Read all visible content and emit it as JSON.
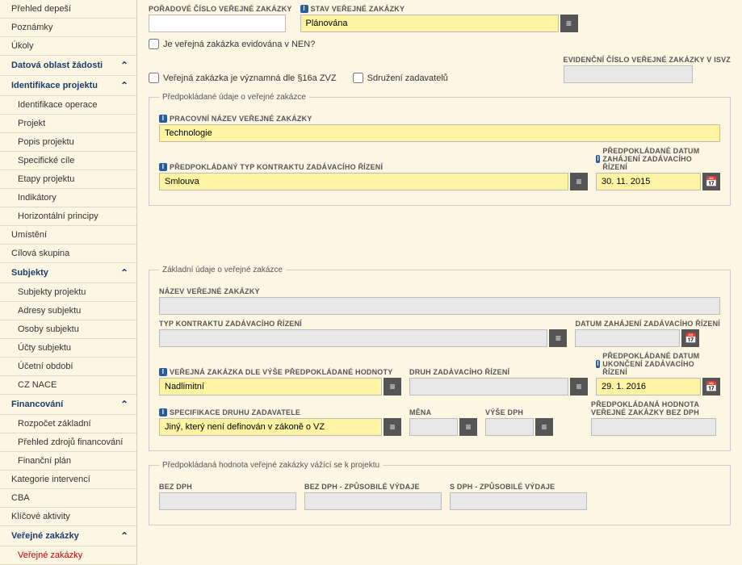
{
  "sidebar": {
    "items": [
      {
        "label": "Přehled depeší",
        "type": "item"
      },
      {
        "label": "Poznámky",
        "type": "item"
      },
      {
        "label": "Úkoly",
        "type": "item"
      },
      {
        "label": "Datová oblast žádosti",
        "type": "header",
        "expand": true
      },
      {
        "label": "Identifikace projektu",
        "type": "header",
        "expand": true
      },
      {
        "label": "Identifikace operace",
        "type": "sub"
      },
      {
        "label": "Projekt",
        "type": "sub"
      },
      {
        "label": "Popis projektu",
        "type": "sub"
      },
      {
        "label": "Specifické cíle",
        "type": "sub"
      },
      {
        "label": "Etapy projektu",
        "type": "sub"
      },
      {
        "label": "Indikátory",
        "type": "sub"
      },
      {
        "label": "Horizontální principy",
        "type": "sub"
      },
      {
        "label": "Umístění",
        "type": "item"
      },
      {
        "label": "Cílová skupina",
        "type": "item"
      },
      {
        "label": "Subjekty",
        "type": "header",
        "expand": true
      },
      {
        "label": "Subjekty projektu",
        "type": "sub"
      },
      {
        "label": "Adresy subjektu",
        "type": "sub"
      },
      {
        "label": "Osoby subjektu",
        "type": "sub"
      },
      {
        "label": "Účty subjektu",
        "type": "sub"
      },
      {
        "label": "Účetní období",
        "type": "sub"
      },
      {
        "label": "CZ NACE",
        "type": "sub"
      },
      {
        "label": "Financování",
        "type": "header",
        "expand": true
      },
      {
        "label": "Rozpočet základní",
        "type": "sub"
      },
      {
        "label": "Přehled zdrojů financování",
        "type": "sub"
      },
      {
        "label": "Finanční plán",
        "type": "sub"
      },
      {
        "label": "Kategorie intervencí",
        "type": "item"
      },
      {
        "label": "CBA",
        "type": "item"
      },
      {
        "label": "Klíčové aktivity",
        "type": "item"
      },
      {
        "label": "Veřejné zakázky",
        "type": "header",
        "expand": true
      },
      {
        "label": "Veřejné zakázky",
        "type": "sub",
        "active": true
      }
    ]
  },
  "top": {
    "poradove_label": "POŘADOVÉ ČÍSLO VEŘEJNÉ ZAKÁZKY",
    "poradove_value": "",
    "stav_label": "STAV VEŘEJNÉ ZAKÁZKY",
    "stav_value": "Plánována",
    "nen_label": "Je veřejná zakázka evidována v NEN?",
    "vyznamna_label": "Veřejná zakázka je významná dle §16a ZVZ",
    "sdruzeni_label": "Sdružení zadavatelů",
    "evidencni_label": "EVIDENČNÍ ČÍSLO VEŘEJNÉ ZAKÁZKY V ISVZ",
    "evidencni_value": ""
  },
  "fs1": {
    "legend": "Předpokládané údaje o veřejné zakázce",
    "pracovni_label": "PRACOVNÍ NÁZEV VEŘEJNÉ ZAKÁZKY",
    "pracovni_value": "Technologie",
    "typ_label": "PŘEDPOKLÁDANÝ TYP KONTRAKTU ZADÁVACÍHO ŘÍZENÍ",
    "typ_value": "Smlouva",
    "datum_zahajeni_label": "PŘEDPOKLÁDANÉ DATUM ZAHÁJENÍ ZADÁVACÍHO ŘÍZENÍ",
    "datum_zahajeni_value": "30. 11. 2015"
  },
  "fs2": {
    "legend": "Základní údaje o veřejné zakázce",
    "nazev_label": "NÁZEV VEŘEJNÉ ZAKÁZKY",
    "nazev_value": "",
    "typ_kontraktu_label": "TYP KONTRAKTU ZADÁVACÍHO ŘÍZENÍ",
    "typ_kontraktu_value": "",
    "datum_zahajeni_label": "DATUM ZAHÁJENÍ ZADÁVACÍHO ŘÍZENÍ",
    "datum_zahajeni_value": "",
    "vz_vyse_label": "VEŘEJNÁ ZAKÁZKA DLE VÝŠE PŘEDPOKLÁDANÉ HODNOTY",
    "vz_vyse_value": "Nadlimitní",
    "druh_rizeni_label": "DRUH ZADÁVACÍHO ŘÍZENÍ",
    "druh_rizeni_value": "",
    "datum_ukonceni_label": "PŘEDPOKLÁDANÉ DATUM UKONČENÍ ZADÁVACÍHO ŘÍZENÍ",
    "datum_ukonceni_value": "29. 1. 2016",
    "spec_druhu_label": "SPECIFIKACE DRUHU ZADAVATELE",
    "spec_druhu_value": "Jiný, který není definován v zákoně o VZ",
    "mena_label": "MĚNA",
    "mena_value": "",
    "vyse_dph_label": "VÝŠE DPH",
    "vyse_dph_value": "",
    "hodnota_bezdph_label": "PŘEDPOKLÁDANÁ HODNOTA VEŘEJNÉ ZAKÁZKY BEZ DPH",
    "hodnota_bezdph_value": ""
  },
  "fs3": {
    "legend": "Předpokládaná hodnota veřejné zakázky vážící se k projektu",
    "bez_dph_label": "BEZ DPH",
    "bez_dph_value": "",
    "bez_dph_zpusobile_label": "BEZ DPH - ZPŮSOBILÉ VÝDAJE",
    "bez_dph_zpusobile_value": "",
    "s_dph_zpusobile_label": "S DPH - ZPŮSOBILÉ VÝDAJE",
    "s_dph_zpusobile_value": ""
  }
}
